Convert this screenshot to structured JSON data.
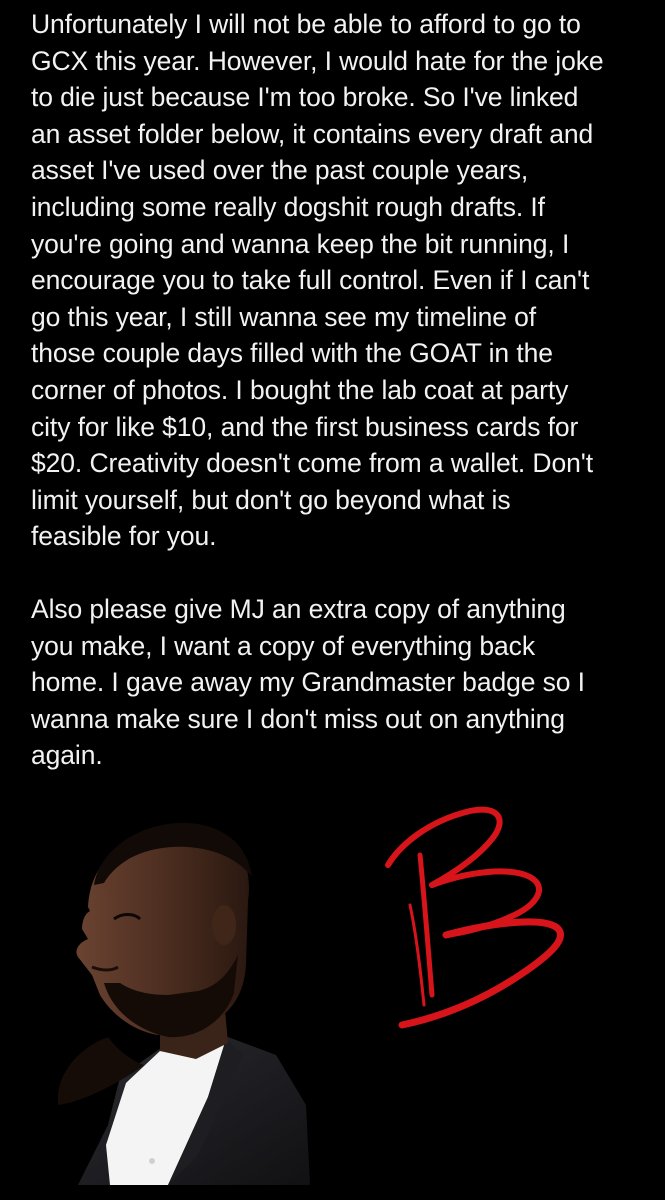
{
  "post": {
    "paragraphs": [
      {
        "lines": [
          "Unfortunately I will not be able to afford to go to",
          "GCX this year. However, I would hate for the joke",
          "to die just because I'm too broke. So I've linked",
          "an asset folder below, it contains every draft and",
          "asset I've used over the past couple years,",
          "including some really dogshit rough drafts. If",
          "you're going and wanna keep the bit running, I",
          "encourage you to take full control. Even if I can't",
          "go this year, I still wanna see my timeline of",
          "those couple days filled with the GOAT in the",
          "corner of photos. I bought the lab coat at party",
          "city for like $10, and the first business cards for",
          "$20. Creativity doesn't come from a wallet. Don't",
          "limit yourself, but don't go beyond what is",
          "feasible for you."
        ]
      },
      {
        "lines": [
          "Also please give MJ an extra copy of anything",
          "you make, I want a copy of everything back",
          "home. I gave away my Grandmaster badge so I",
          "wanna make sure I don't miss out on anything",
          "again."
        ]
      }
    ]
  },
  "images": {
    "portrait": "man-in-suit-portrait",
    "signature": "red-B-signature"
  },
  "colors": {
    "background": "#000000",
    "text": "#f2f2f2",
    "signature": "#d8141b"
  }
}
